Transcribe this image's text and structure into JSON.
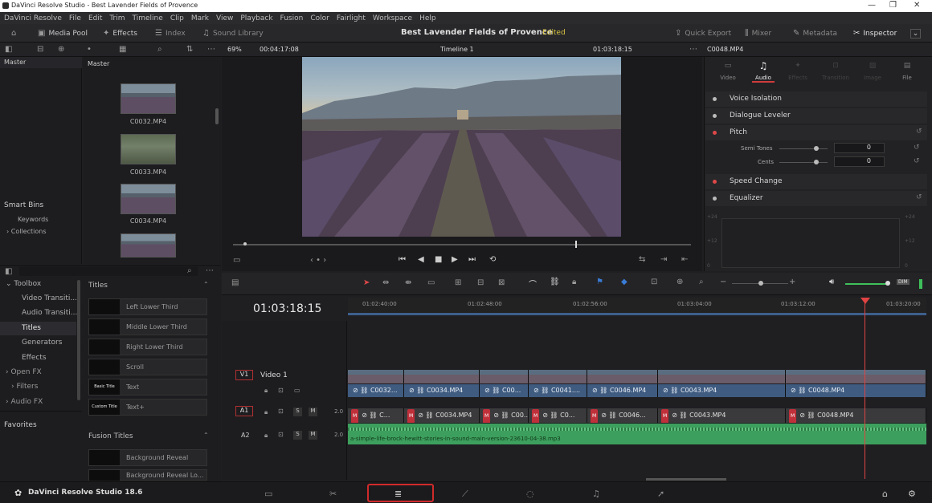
{
  "window": {
    "title": "DaVinci Resolve Studio - Best Lavender Fields of Provence"
  },
  "menu": [
    "DaVinci Resolve",
    "File",
    "Edit",
    "Trim",
    "Timeline",
    "Clip",
    "Mark",
    "View",
    "Playback",
    "Fusion",
    "Color",
    "Fairlight",
    "Workspace",
    "Help"
  ],
  "toolbar": {
    "media_pool": "Media Pool",
    "effects": "Effects",
    "index": "Index",
    "sound_library": "Sound Library",
    "project_title": "Best Lavender Fields of Provence",
    "edited": "Edited",
    "quick_export": "Quick Export",
    "mixer": "Mixer",
    "metadata": "Metadata",
    "inspector": "Inspector"
  },
  "viewer": {
    "zoom": "69%",
    "duration": "00:04:17:08",
    "timeline_name": "Timeline 1",
    "timecode": "01:03:18:15",
    "clip_name": "C0048.MP4"
  },
  "media_pool": {
    "master_left": "Master",
    "master_right": "Master",
    "smart_bins": "Smart Bins",
    "keywords": "Keywords",
    "collections": "Collections",
    "clips": [
      "C0032.MP4",
      "C0033.MP4",
      "C0034.MP4"
    ]
  },
  "inspector": {
    "tabs": [
      "Video",
      "Audio",
      "Effects",
      "Transition",
      "Image",
      "File"
    ],
    "active_tab": "Audio",
    "rows": [
      "Voice Isolation",
      "Dialogue Leveler",
      "Pitch",
      "Speed Change",
      "Equalizer"
    ],
    "semi_tones_label": "Semi Tones",
    "semi_tones_value": "0",
    "cents_label": "Cents",
    "cents_value": "0",
    "eq_left_labels": [
      "+24",
      "+12",
      "0"
    ],
    "eq_right_labels": [
      "+24",
      "+12",
      "0"
    ]
  },
  "effects_panel": {
    "toolbox": "Toolbox",
    "items": [
      "Video Transiti...",
      "Audio Transiti...",
      "Titles",
      "Generators",
      "Effects"
    ],
    "open_fx": "Open FX",
    "filters": "Filters",
    "audio_fx": "Audio FX",
    "favorites": "Favorites",
    "titles_header": "Titles",
    "titles": [
      {
        "thumb": "",
        "name": "Left Lower Third"
      },
      {
        "thumb": "",
        "name": "Middle Lower Third"
      },
      {
        "thumb": "",
        "name": "Right Lower Third"
      },
      {
        "thumb": "",
        "name": "Scroll"
      },
      {
        "thumb": "Basic Title",
        "name": "Text"
      },
      {
        "thumb": "Custom Title",
        "name": "Text+"
      }
    ],
    "fusion_header": "Fusion Titles",
    "fusion": [
      {
        "thumb": "",
        "name": "Background Reveal"
      },
      {
        "thumb": "",
        "name": "Background Reveal Lo..."
      }
    ]
  },
  "timeline": {
    "timecode": "01:03:18:15",
    "ruler": [
      "01:02:40:00",
      "01:02:48:00",
      "01:02:56:00",
      "01:03:04:00",
      "01:03:12:00",
      "01:03:20:00"
    ],
    "v1": "V1",
    "v1_name": "Video 1",
    "a1": "A1",
    "a1_level": "2.0",
    "a2": "A2",
    "a2_level": "2.0",
    "audio_file": "a-simple-life-brock-hewitt-stories-in-sound-main-version-23610-04-38.mp3",
    "video_clips": [
      "C0032...",
      "C0034.MP4",
      "C00...",
      "C0041....",
      "C0046.MP4",
      "C0043.MP4",
      "C0048.MP4"
    ],
    "audio_clips": [
      "C...",
      "C0034.MP4",
      "C00...",
      "C0...",
      "C0046...",
      "C0043.MP4",
      "C0048.MP4"
    ]
  },
  "footer": {
    "app": "DaVinci Resolve Studio 18.6"
  }
}
